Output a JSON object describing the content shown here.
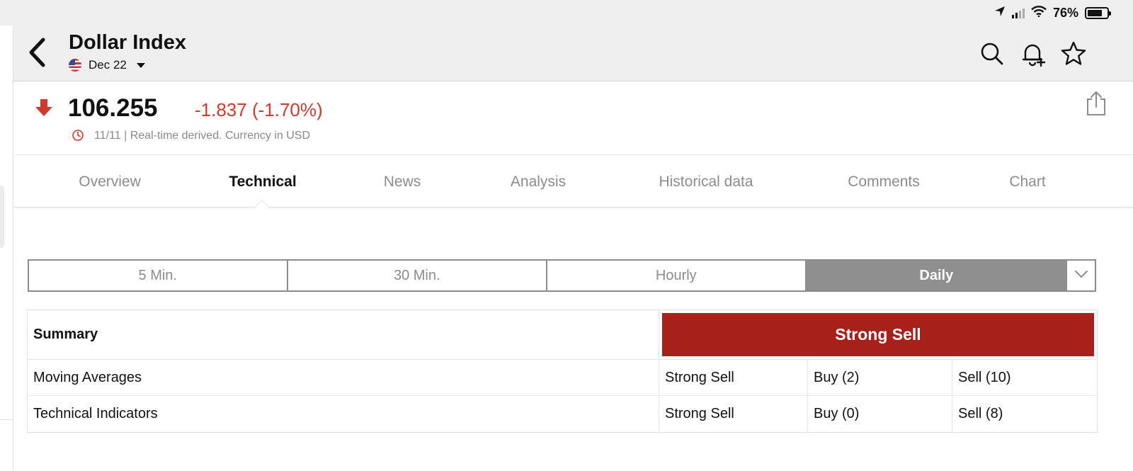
{
  "status_bar": {
    "battery": "76%",
    "battery_level": 0.76
  },
  "header": {
    "title": "Dollar Index",
    "contract": "Dec 22",
    "icons": [
      "back-chevron-icon",
      "search-icon",
      "add-alert-bell-icon",
      "star-icon"
    ]
  },
  "quote": {
    "price": "106.255",
    "change": "-1.837 (-1.70%)",
    "direction": "down",
    "meta": "11/11 | Real-time derived. Currency in USD",
    "colors": {
      "negative": "#d0392c"
    }
  },
  "tabs": [
    {
      "label": "Overview",
      "active": false
    },
    {
      "label": "Technical",
      "active": true
    },
    {
      "label": "News",
      "active": false
    },
    {
      "label": "Analysis",
      "active": false
    },
    {
      "label": "Historical data",
      "active": false
    },
    {
      "label": "Comments",
      "active": false
    },
    {
      "label": "Chart",
      "active": false
    }
  ],
  "timeframes": {
    "options": [
      "5 Min.",
      "30 Min.",
      "Hourly",
      "Daily"
    ],
    "selected": "Daily"
  },
  "summary": {
    "label": "Summary",
    "verdict": "Strong Sell",
    "verdict_color": "#a8201a",
    "rows": [
      {
        "label": "Moving Averages",
        "signal": "Strong Sell",
        "buy": "Buy (2)",
        "sell": "Sell (10)"
      },
      {
        "label": "Technical Indicators",
        "signal": "Strong Sell",
        "buy": "Buy (0)",
        "sell": "Sell (8)"
      }
    ]
  }
}
